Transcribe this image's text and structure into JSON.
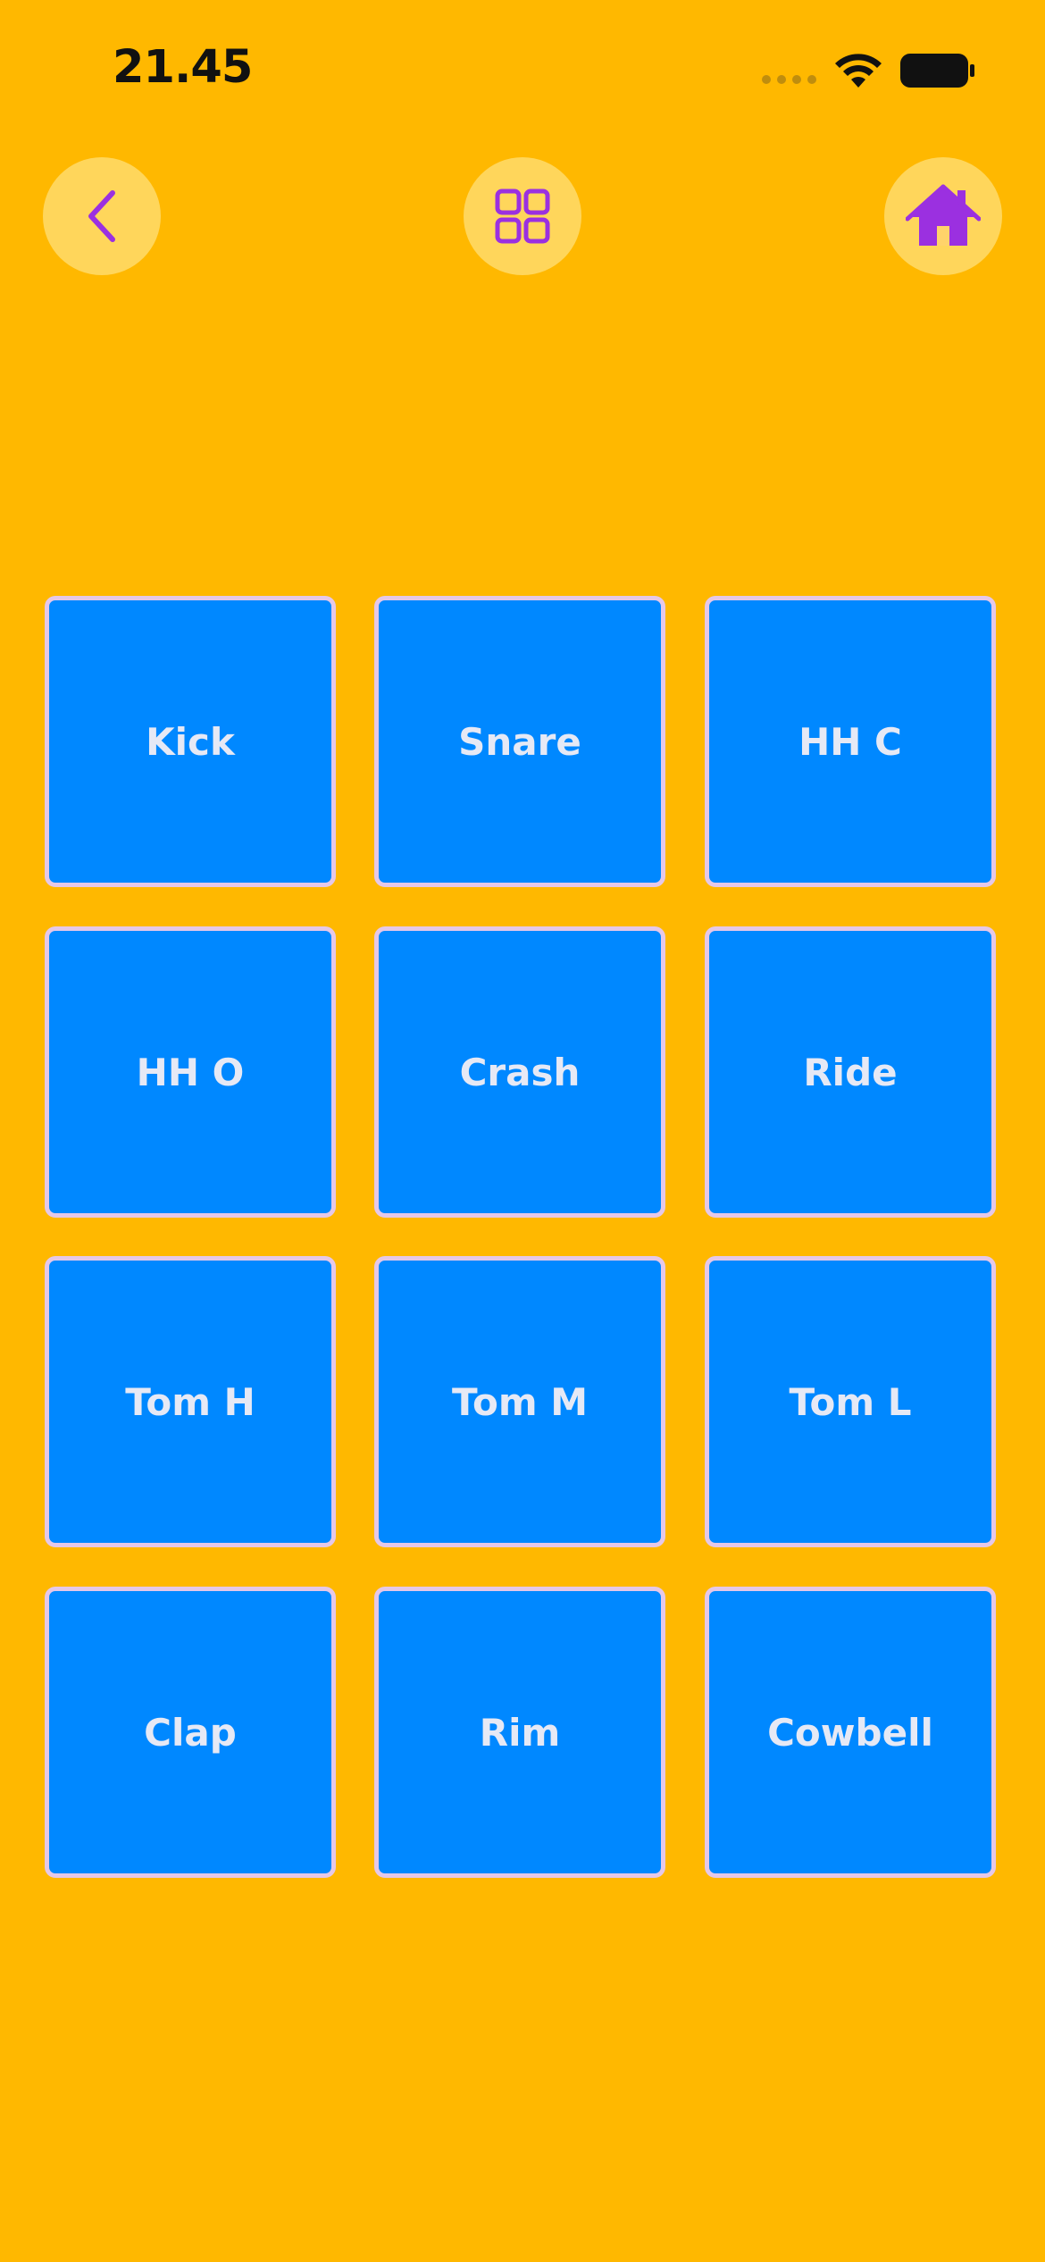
{
  "status_bar": {
    "time": "21.45"
  },
  "nav": {
    "back_icon": "chevron-left-icon",
    "grid_icon": "grid-icon",
    "home_icon": "home-icon",
    "icon_color": "#9B30E0"
  },
  "pads": [
    {
      "label": "Kick"
    },
    {
      "label": "Snare"
    },
    {
      "label": "HH C"
    },
    {
      "label": "HH O"
    },
    {
      "label": "Crash"
    },
    {
      "label": "Ride"
    },
    {
      "label": "Tom H"
    },
    {
      "label": "Tom M"
    },
    {
      "label": "Tom L"
    },
    {
      "label": "Clap"
    },
    {
      "label": "Rim"
    },
    {
      "label": "Cowbell"
    }
  ],
  "colors": {
    "background": "#FFB800",
    "pad": "#0088FF",
    "pad_border": "#E5C8E8",
    "pad_text": "#E6E9F5"
  }
}
